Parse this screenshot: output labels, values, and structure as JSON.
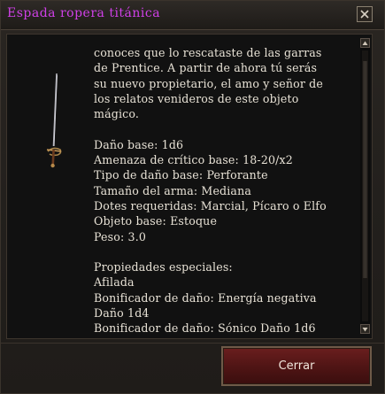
{
  "window": {
    "title": "Espada ropera titánica",
    "title_color": "#d040e8"
  },
  "item": {
    "image": "rapier-sword-icon",
    "description": [
      "conoces que lo rescataste de las garras",
      "de Prentice. A partir de ahora tú serás",
      "su nuevo propietario, el amo y señor de",
      "los relatos venideros de este objeto",
      "mágico."
    ],
    "stats": [
      "Daño base: 1d6",
      "Amenaza de crítico base: 18-20/x2",
      "Tipo de daño base: Perforante",
      "Tamaño del arma: Mediana",
      "Dotes requeridas: Marcial, Pícaro o Elfo",
      "Objeto base: Estoque",
      "Peso: 3.0"
    ],
    "properties": [
      "Propiedades especiales:",
      "Afilada",
      "Bonificador de daño: Energía negativa",
      "Daño 1d4",
      "Bonificador de daño: Sónico Daño 1d6"
    ]
  },
  "buttons": {
    "close_icon": "close-icon",
    "ok_label": "Cerrar",
    "ok_color": "#5a1818"
  },
  "scrollbar": {
    "position": 0.19
  }
}
